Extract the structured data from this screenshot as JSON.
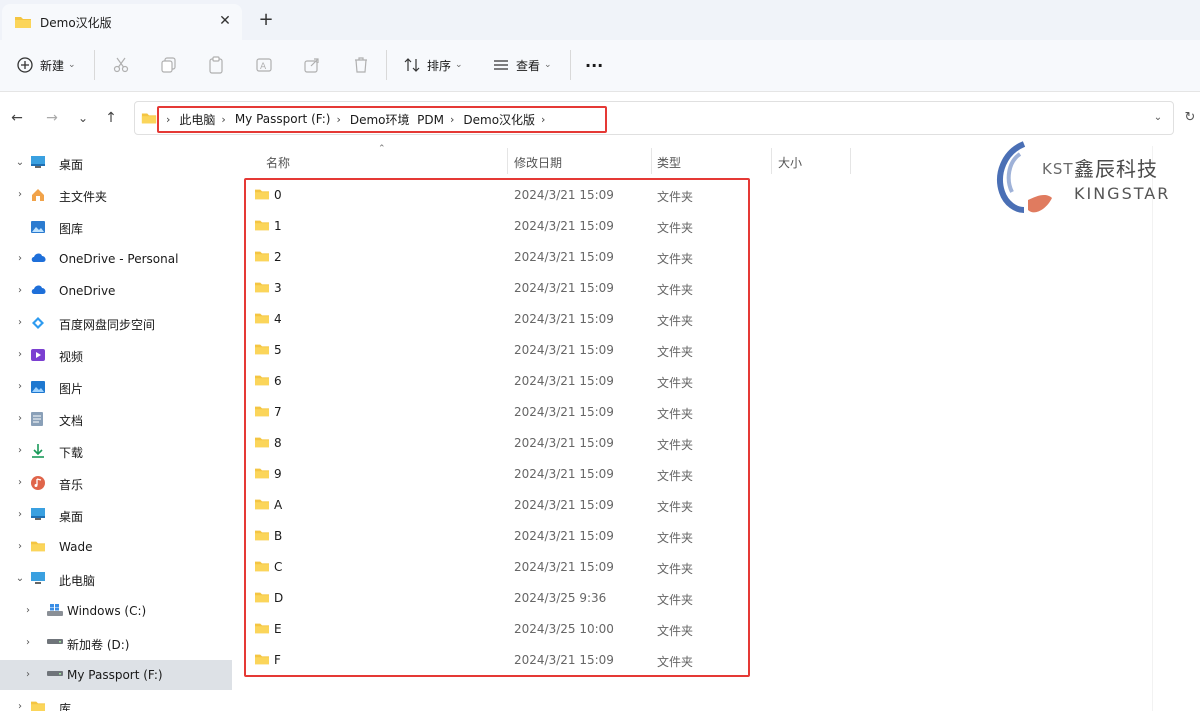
{
  "tab": {
    "title": "Demo汉化版",
    "close": "✕",
    "new_tab": "+"
  },
  "toolbar": {
    "new_label": "新建",
    "sort_label": "排序",
    "view_label": "查看",
    "more": "···"
  },
  "nav": {
    "back": "←",
    "forward": "→",
    "recent": "⌄",
    "up": "↑",
    "breadcrumb": [
      "此电脑",
      "My Passport (F:)",
      "Demo环境  PDM",
      "Demo汉化版"
    ],
    "refresh": "↻"
  },
  "sidebar": {
    "items": [
      {
        "label": "桌面",
        "icon": "desktop-icon",
        "expand": "collapse"
      },
      {
        "label": "主文件夹",
        "icon": "home-icon",
        "expand": "expand"
      },
      {
        "label": "图库",
        "icon": "gallery-icon",
        "expand": "none"
      },
      {
        "label": "OneDrive - Personal",
        "icon": "cloud-icon",
        "expand": "expand"
      },
      {
        "label": "OneDrive",
        "icon": "cloud-icon",
        "expand": "expand"
      },
      {
        "label": "百度网盘同步空间",
        "icon": "baidu-netdisk-icon",
        "expand": "expand"
      },
      {
        "label": "视频",
        "icon": "video-icon",
        "expand": "expand"
      },
      {
        "label": "图片",
        "icon": "picture-icon",
        "expand": "expand"
      },
      {
        "label": "文档",
        "icon": "document-icon",
        "expand": "expand"
      },
      {
        "label": "下载",
        "icon": "download-icon",
        "expand": "expand"
      },
      {
        "label": "音乐",
        "icon": "music-icon",
        "expand": "expand"
      },
      {
        "label": "桌面",
        "icon": "desktop-icon",
        "expand": "expand"
      },
      {
        "label": "Wade",
        "icon": "folder-icon",
        "expand": "expand"
      },
      {
        "label": "此电脑",
        "icon": "computer-icon",
        "expand": "collapse"
      },
      {
        "label": "Windows (C:)",
        "icon": "windows-drive-icon",
        "expand": "expand"
      },
      {
        "label": "新加卷 (D:)",
        "icon": "drive-icon",
        "expand": "expand"
      },
      {
        "label": "My Passport (F:)",
        "icon": "drive-icon",
        "expand": "expand",
        "selected": true
      },
      {
        "label": "库",
        "icon": "folder-icon",
        "expand": "expand"
      }
    ]
  },
  "columns": {
    "name": "名称",
    "modified": "修改日期",
    "type": "类型",
    "size": "大小"
  },
  "files": [
    {
      "name": "0",
      "date": "2024/3/21 15:09",
      "type": "文件夹"
    },
    {
      "name": "1",
      "date": "2024/3/21 15:09",
      "type": "文件夹"
    },
    {
      "name": "2",
      "date": "2024/3/21 15:09",
      "type": "文件夹"
    },
    {
      "name": "3",
      "date": "2024/3/21 15:09",
      "type": "文件夹"
    },
    {
      "name": "4",
      "date": "2024/3/21 15:09",
      "type": "文件夹"
    },
    {
      "name": "5",
      "date": "2024/3/21 15:09",
      "type": "文件夹"
    },
    {
      "name": "6",
      "date": "2024/3/21 15:09",
      "type": "文件夹"
    },
    {
      "name": "7",
      "date": "2024/3/21 15:09",
      "type": "文件夹"
    },
    {
      "name": "8",
      "date": "2024/3/21 15:09",
      "type": "文件夹"
    },
    {
      "name": "9",
      "date": "2024/3/21 15:09",
      "type": "文件夹"
    },
    {
      "name": "A",
      "date": "2024/3/21 15:09",
      "type": "文件夹"
    },
    {
      "name": "B",
      "date": "2024/3/21 15:09",
      "type": "文件夹"
    },
    {
      "name": "C",
      "date": "2024/3/21 15:09",
      "type": "文件夹"
    },
    {
      "name": "D",
      "date": "2024/3/25 9:36",
      "type": "文件夹"
    },
    {
      "name": "E",
      "date": "2024/3/25 10:00",
      "type": "文件夹"
    },
    {
      "name": "F",
      "date": "2024/3/21 15:09",
      "type": "文件夹"
    }
  ],
  "logo": {
    "kst": "KST",
    "cn": "鑫辰科技",
    "en": "KINGSTAR"
  },
  "colors": {
    "highlight": "#e53935",
    "folder": "#f4c542",
    "selected_bg": "#dde1e6"
  }
}
